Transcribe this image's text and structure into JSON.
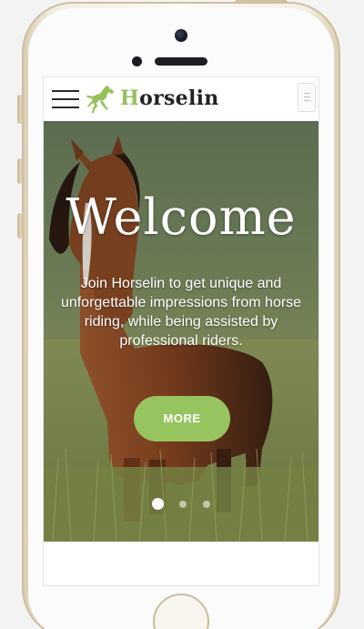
{
  "brand": {
    "first_letter": "H",
    "rest": "orselin",
    "accent_color": "#95c15b"
  },
  "header": {
    "menu_icon": "hamburger-menu-icon",
    "logo_icon": "horse-logo-icon",
    "toggle_icon": "collapse-toggle-icon"
  },
  "hero": {
    "title": "Welcome",
    "text": "Join Horselin to get unique and unforgettable impressions from horse riding, while being assisted by professional riders.",
    "button_label": "MORE",
    "button_color": "#97c45e",
    "slides_total": 3,
    "active_slide": 1
  }
}
